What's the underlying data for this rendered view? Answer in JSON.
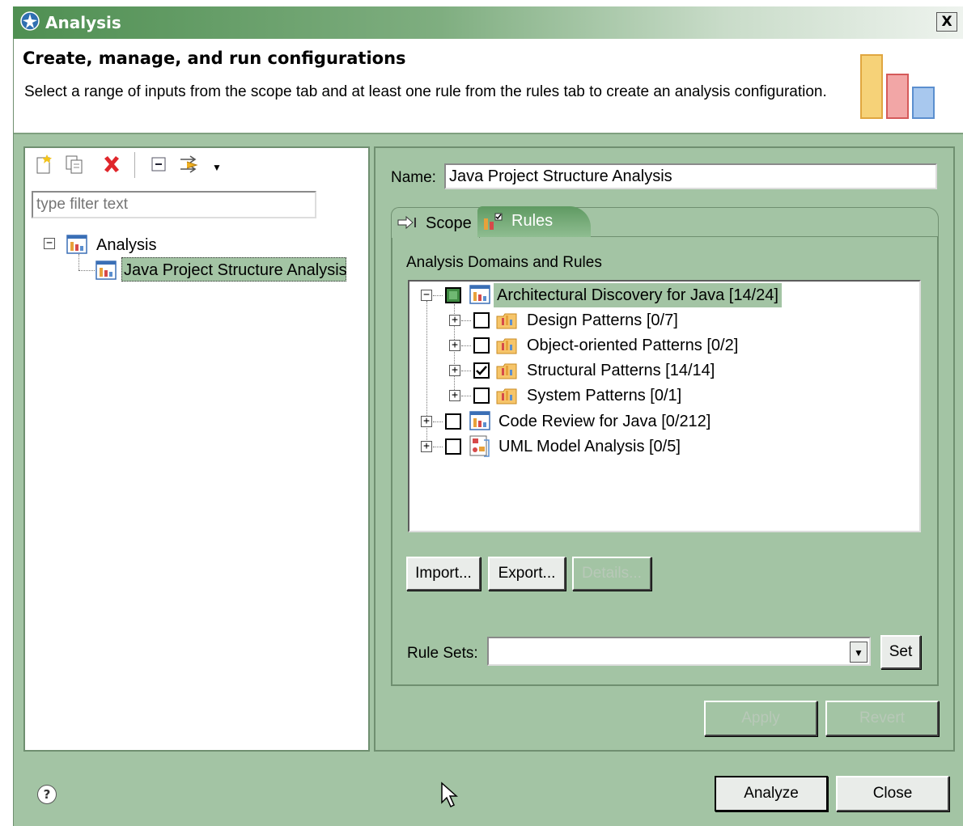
{
  "window": {
    "title": "Analysis",
    "close_label": "X"
  },
  "banner": {
    "title": "Create, manage, and run configurations",
    "message": "Select a range of inputs from the scope tab and at least one rule from the rules tab to create an analysis configuration."
  },
  "left": {
    "toolbar": [
      "new-configuration-icon",
      "duplicate-icon",
      "delete-icon",
      "collapse-all-icon",
      "filter-icon",
      "view-menu-icon"
    ],
    "filter_placeholder": "type filter text",
    "tree": {
      "root_label": "Analysis",
      "child_label": "Java Project Structure Analysis"
    }
  },
  "right": {
    "name_label": "Name:",
    "name_value": "Java Project Structure Analysis",
    "tabs": [
      {
        "label": "Scope",
        "selected": false
      },
      {
        "label": "Rules",
        "selected": true
      }
    ],
    "domains_label": "Analysis Domains and Rules",
    "rules": [
      {
        "label": "Architectural Discovery for Java [14/24]",
        "level": 0,
        "expanded": true,
        "check": "partial"
      },
      {
        "label": "Design Patterns [0/7]",
        "level": 1,
        "expanded": false,
        "check": "unchecked"
      },
      {
        "label": "Object-oriented Patterns [0/2]",
        "level": 1,
        "expanded": false,
        "check": "unchecked"
      },
      {
        "label": "Structural Patterns [14/14]",
        "level": 1,
        "expanded": false,
        "check": "checked"
      },
      {
        "label": "System Patterns [0/1]",
        "level": 1,
        "expanded": false,
        "check": "unchecked"
      },
      {
        "label": "Code Review for Java [0/212]",
        "level": 0,
        "expanded": false,
        "check": "unchecked"
      },
      {
        "label": "UML Model Analysis [0/5]",
        "level": 0,
        "expanded": false,
        "check": "unchecked"
      }
    ],
    "import_label": "Import...",
    "export_label": "Export...",
    "details_label": "Details...",
    "rulesets_label": "Rule Sets:",
    "rulesets_value": "",
    "set_label": "Set",
    "apply_label": "Apply",
    "revert_label": "Revert"
  },
  "footer": {
    "analyze_label": "Analyze",
    "close_label": "Close",
    "help_glyph": "?"
  },
  "colors": {
    "dialog_bg": "#a3c4a4",
    "titlebar_start": "#4f8f52",
    "selected_tab": "#5f9a62"
  }
}
